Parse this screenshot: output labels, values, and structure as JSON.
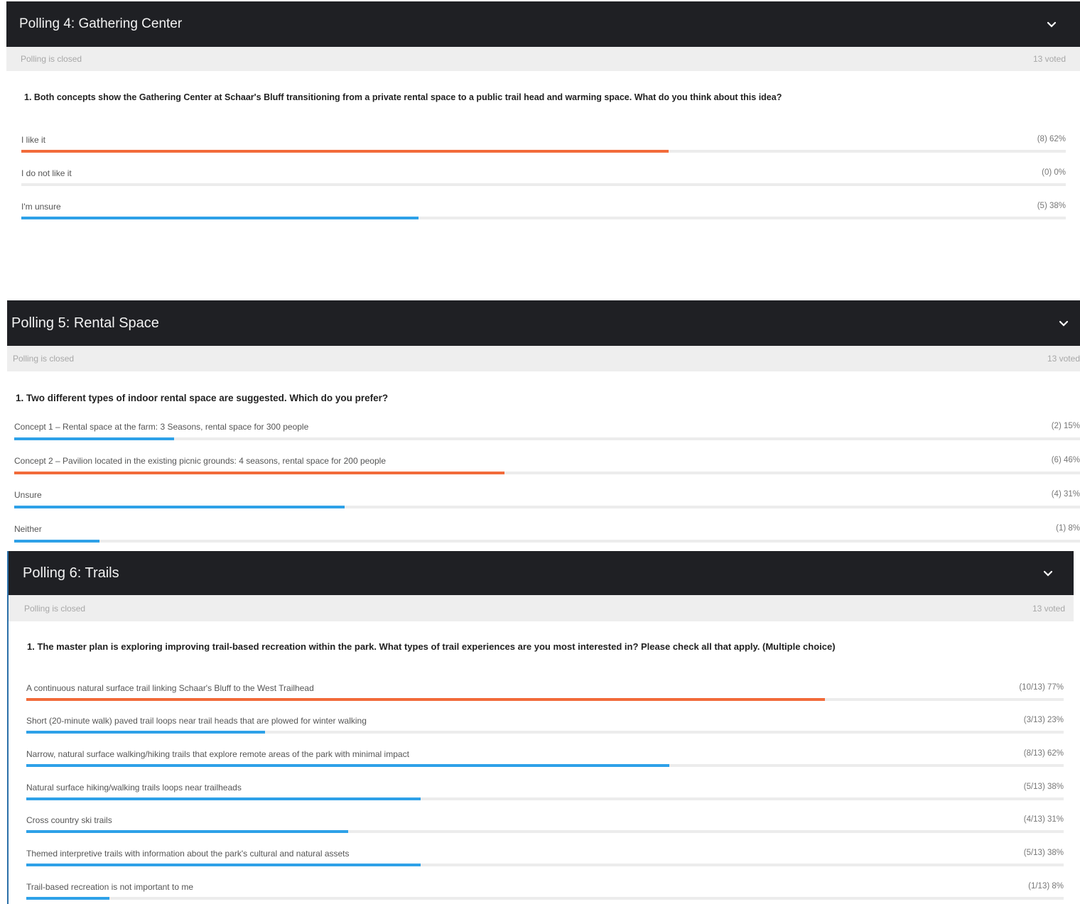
{
  "polls": [
    {
      "title": "Polling 4: Gathering Center",
      "status": "Polling is closed",
      "voted": "13 voted",
      "question": "1. Both concepts show the Gathering Center at Schaar's Bluff transitioning from a private rental space to a public trail head and warming space.  What do you think about this idea?",
      "options": [
        {
          "label": "I like it",
          "result": "(8) 62%",
          "percent": 62,
          "color": "#f26b3a"
        },
        {
          "label": "I do not like it",
          "result": "(0) 0%",
          "percent": 0,
          "color": "#2ea1e8"
        },
        {
          "label": "I'm unsure",
          "result": "(5) 38%",
          "percent": 38,
          "color": "#2ea1e8"
        }
      ]
    },
    {
      "title": "Polling 5: Rental Space",
      "status": "Polling is closed",
      "voted": "13 voted",
      "question": "1. Two different types of indoor rental space are suggested.  Which do you prefer?",
      "options": [
        {
          "label": "Concept 1 – Rental space at the farm: 3 Seasons, rental space for 300 people",
          "result": "(2) 15%",
          "percent": 15,
          "color": "#2ea1e8"
        },
        {
          "label": "Concept 2 – Pavilion located in the existing picnic grounds: 4 seasons, rental space for 200 people",
          "result": "(6) 46%",
          "percent": 46,
          "color": "#f26b3a"
        },
        {
          "label": "Unsure",
          "result": "(4) 31%",
          "percent": 31,
          "color": "#2ea1e8"
        },
        {
          "label": "Neither",
          "result": "(1) 8%",
          "percent": 8,
          "color": "#2ea1e8"
        }
      ]
    },
    {
      "title": "Polling 6: Trails",
      "status": "Polling is closed",
      "voted": "13 voted",
      "question": "1. The master plan is exploring improving trail-based recreation within the park.  What types of trail experiences are you most interested in?  Please check all that apply. (Multiple choice)",
      "options": [
        {
          "label": "A continuous natural surface trail linking Schaar's Bluff to the West Trailhead",
          "result": "(10/13) 77%",
          "percent": 77,
          "color": "#f26b3a"
        },
        {
          "label": "Short (20-minute walk) paved trail loops near trail heads that are plowed for winter walking",
          "result": "(3/13) 23%",
          "percent": 23,
          "color": "#2ea1e8"
        },
        {
          "label": "Narrow, natural surface walking/hiking trails that explore remote areas of the park with minimal impact",
          "result": "(8/13) 62%",
          "percent": 62,
          "color": "#2ea1e8"
        },
        {
          "label": "Natural surface hiking/walking trails loops near trailheads",
          "result": "(5/13) 38%",
          "percent": 38,
          "color": "#2ea1e8"
        },
        {
          "label": "Cross country ski trails",
          "result": "(4/13) 31%",
          "percent": 31,
          "color": "#2ea1e8"
        },
        {
          "label": "Themed interpretive trails with information about the park's cultural and natural assets",
          "result": "(5/13) 38%",
          "percent": 38,
          "color": "#2ea1e8"
        },
        {
          "label": "Trail-based recreation is not important to me",
          "result": "(1/13) 8%",
          "percent": 8,
          "color": "#2ea1e8"
        }
      ]
    }
  ]
}
